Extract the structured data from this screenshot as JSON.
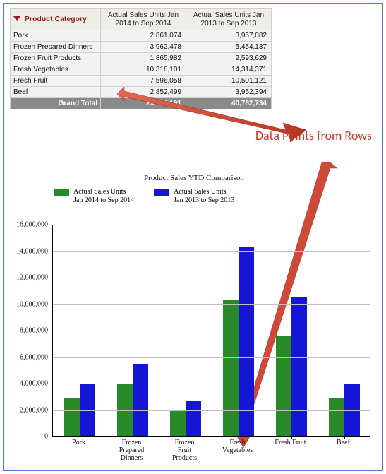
{
  "table": {
    "corner_label": "Product Category",
    "columns": [
      "Actual Sales Units\nJan 2014 to Sep 2014",
      "Actual Sales Units\nJan 2013 to Sep 2013"
    ],
    "rows": [
      {
        "category": "Pork",
        "v2014": "2,861,074",
        "v2013": "3,967,082"
      },
      {
        "category": "Frozen Prepared Dinners",
        "v2014": "3,962,478",
        "v2013": "5,454,137"
      },
      {
        "category": "Frozen Fruit Products",
        "v2014": "1,865,982",
        "v2013": "2,593,629"
      },
      {
        "category": "Fresh Vegetables",
        "v2014": "10,318,101",
        "v2013": "14,314,371"
      },
      {
        "category": "Fresh Fruit",
        "v2014": "7,596,058",
        "v2013": "10,501,121"
      },
      {
        "category": "Beef",
        "v2014": "2,852,499",
        "v2013": "3,952,394"
      }
    ],
    "total_label": "Grand Total",
    "total_2014": "29,456,191",
    "total_2013": "40,782,734"
  },
  "annotation_text": "Data Points\nfrom Rows",
  "chart_title": "Product Sales YTD Comparison",
  "legend": {
    "series1": "Actual Sales Units\nJan 2014 to Sep 2014",
    "series2": "Actual Sales Units\nJan 2013 to Sep 2013"
  },
  "chart_data": {
    "type": "bar",
    "title": "Product Sales YTD Comparison",
    "categories": [
      "Pork",
      "Frozen Prepared Dinners",
      "Frozen Fruit Products",
      "Fresh Vegetables",
      "Fresh Fruit",
      "Beef"
    ],
    "category_labels": [
      "Pork",
      "Frozen\nPrepared\nDinners",
      "Frozen\nFruit\nProducts",
      "Fresh\nVegetables",
      "Fresh Fruit",
      "Beef"
    ],
    "series": [
      {
        "name": "Actual Sales Units Jan 2014 to Sep 2014",
        "color": "#288a28",
        "values": [
          2861074,
          3962478,
          1865982,
          10318101,
          7596058,
          2852499
        ]
      },
      {
        "name": "Actual Sales Units Jan 2013 to Sep 2013",
        "color": "#1515d6",
        "values": [
          3967082,
          5454137,
          2593629,
          14314371,
          10501121,
          3952394
        ]
      }
    ],
    "ylim": [
      0,
      16000000
    ],
    "ytick_step": 2000000,
    "ylabel": "",
    "xlabel": ""
  }
}
